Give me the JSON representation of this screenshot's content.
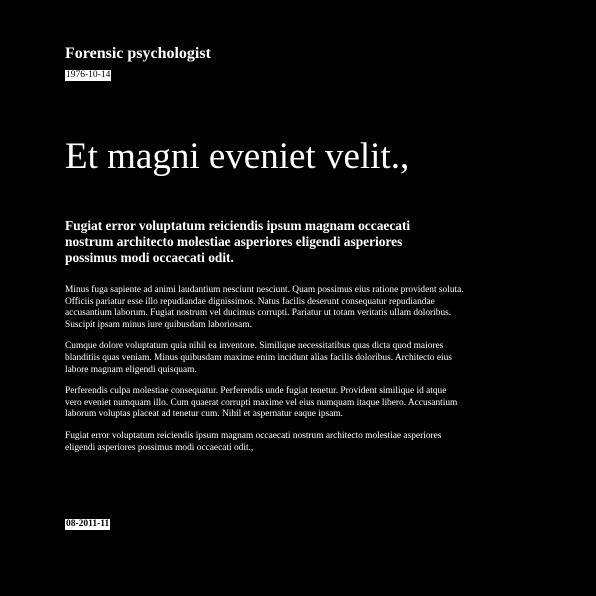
{
  "header": {
    "title": "Forensic psychologist",
    "date": "1976-10-14"
  },
  "article": {
    "headline": "Et magni eveniet velit.,",
    "lede": "Fugiat error voluptatum reiciendis ipsum magnam occaecati nostrum architecto molestiae asperiores eligendi asperiores possimus modi occaecati odit.",
    "paragraphs": [
      "Minus fuga sapiente ad animi laudantium nesciunt nesciunt. Quam possimus eius ratione provident soluta. Officiis pariatur esse illo repudiandae dignissimos. Natus facilis deserunt consequatur repudiandae accusantium laborum. Fugiat nostrum vel ducimus corrupti. Pariatur ut totam veritatis ullam doloribus. Suscipit ipsam minus iure quibusdam laboriosam.",
      "Cumque dolore voluptatum quia nihil ea inventore. Similique necessitatibus quas dicta quod maiores blanditiis quas veniam. Minus quibusdam maxime enim incidunt alias facilis doloribus. Architecto eius labore magnam eligendi quisquam.",
      "Perferendis culpa molestiae consequatur. Perferendis unde fugiat tenetur. Provident similique id atque vero eveniet numquam illo. Cum quaerat corrupti maxime vel eius numquam itaque libero. Accusantium laborum voluptas placeat ad tenetur cum. Nihil et aspernatur eaque ipsam.",
      "Fugiat error voluptatum reiciendis ipsum magnam occaecati nostrum architecto molestiae asperiores eligendi asperiores possimus modi occaecati odit.,"
    ]
  },
  "footer": {
    "date": "08-2011-11"
  }
}
